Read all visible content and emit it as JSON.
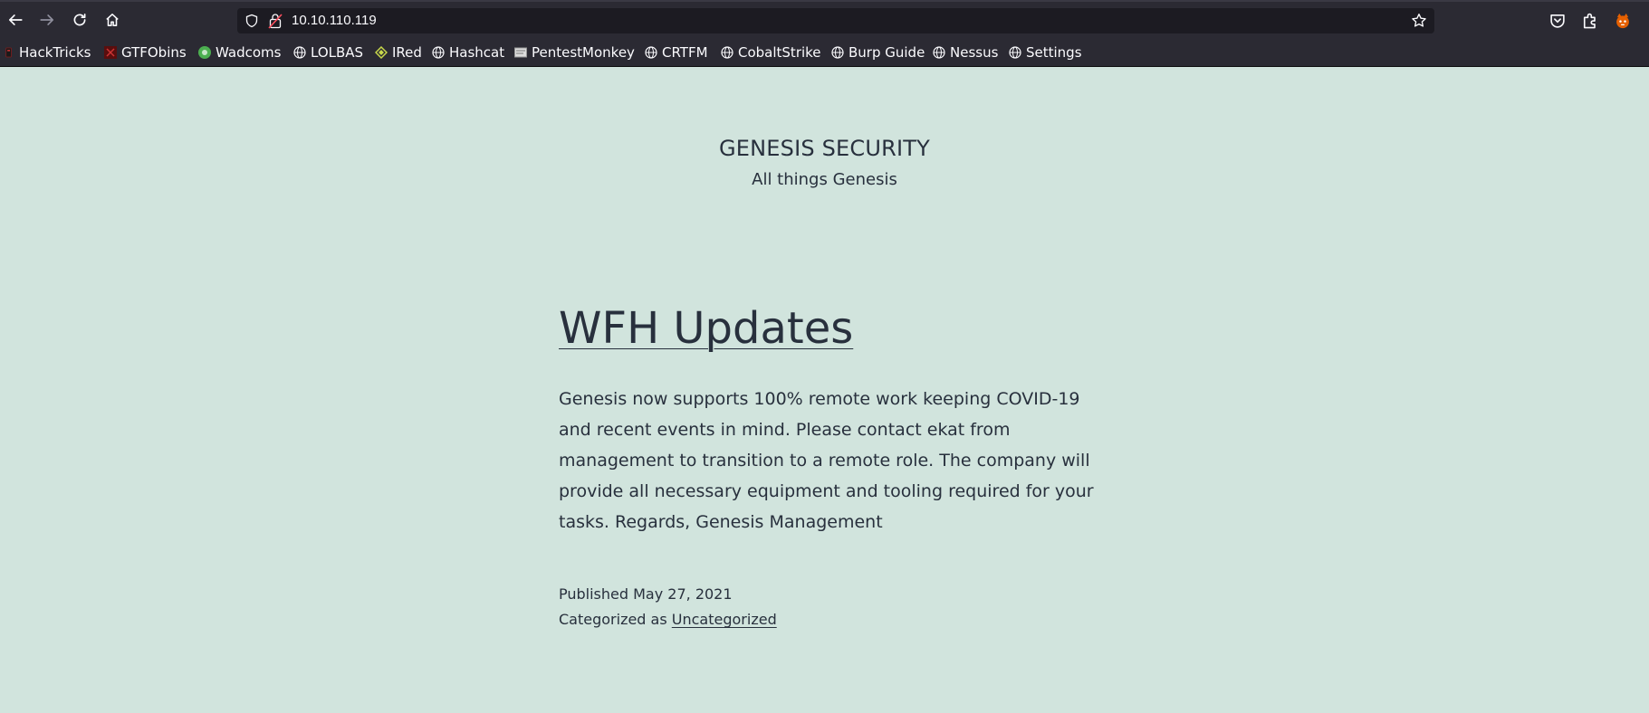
{
  "browser": {
    "url": "10.10.110.119",
    "bookmarks": [
      {
        "label": "HackTricks",
        "icon": "hacktricks-icon"
      },
      {
        "label": "GTFObins",
        "icon": "gtfobins-icon"
      },
      {
        "label": "Wadcoms",
        "icon": "wadcoms-icon"
      },
      {
        "label": "LOLBAS",
        "icon": "globe-icon"
      },
      {
        "label": "IRed",
        "icon": "ired-icon"
      },
      {
        "label": "Hashcat",
        "icon": "globe-icon"
      },
      {
        "label": "PentestMonkey",
        "icon": "pentestmonkey-icon"
      },
      {
        "label": "CRTFM",
        "icon": "globe-icon"
      },
      {
        "label": "CobaltStrike",
        "icon": "globe-icon"
      },
      {
        "label": "Burp Guide",
        "icon": "globe-icon"
      },
      {
        "label": "Nessus",
        "icon": "globe-icon"
      },
      {
        "label": "Settings",
        "icon": "globe-icon"
      }
    ],
    "colors": {
      "chrome": "#2b2a33",
      "urlbar": "#1c1b22",
      "text": "#fbfbfe"
    }
  },
  "site": {
    "title": "GENESIS SECURITY",
    "description": "All things Genesis"
  },
  "post": {
    "title": "WFH Updates",
    "body": "Genesis now supports 100% remote work keeping COVID-19 and recent events in mind. Please contact ekat from management to transition to a remote role. The company will provide all necessary equipment and tooling required for your tasks. Regards, Genesis Management",
    "published_label": "Published May 27, 2021",
    "category_prefix": "Categorized as",
    "category": "Uncategorized"
  },
  "colors": {
    "page_bg": "#d1e4dd",
    "text": "#28303d"
  }
}
